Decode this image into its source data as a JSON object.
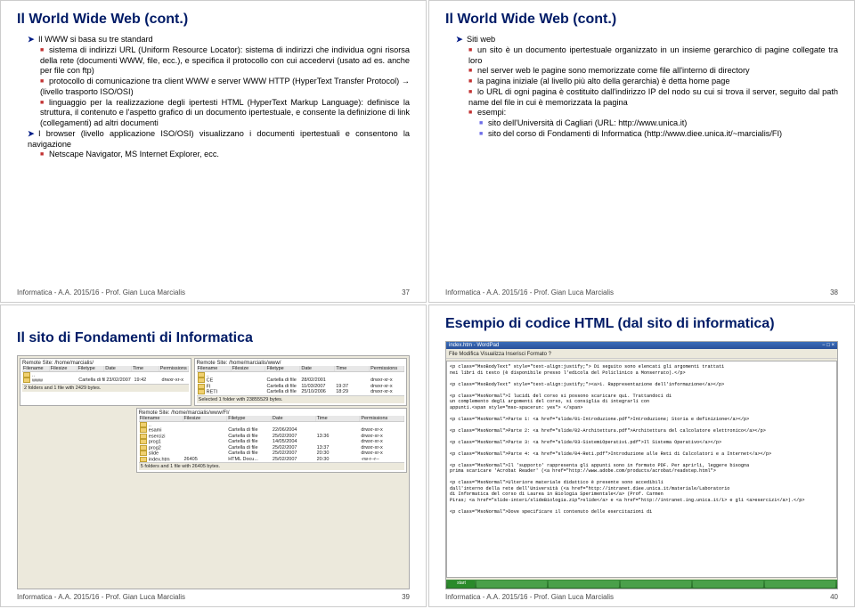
{
  "footer": "Informatica - A.A. 2015/16 - Prof. Gian Luca Marcialis",
  "slides": {
    "s37": {
      "title": "Il World Wide Web (cont.)",
      "num": "37",
      "b1": "Il WWW si basa su tre standard",
      "b1a": "sistema di indirizzi URL (Uniform Resource Locator): sistema di indirizzi che individua ogni risorsa della rete (documenti WWW, file, ecc.), e specifica il protocollo con cui accedervi (usato ad es. anche per file con ftp)",
      "b1b": "protocollo di comunicazione tra client WWW e server WWW HTTP (HyperText Transfer Protocol) → (livello trasporto ISO/OSI)",
      "b1c": "linguaggio per la realizzazione degli ipertesti HTML (HyperText Markup Language): definisce la struttura, il contenuto e l'aspetto grafico di un documento ipertestuale, e consente la definizione di link (collegamenti) ad altri documenti",
      "b2": "I browser (livello applicazione ISO/OSI) visualizzano i documenti ipertestuali e consentono la navigazione",
      "b2a": "Netscape Navigator, MS Internet Explorer, ecc."
    },
    "s38": {
      "title": "Il World Wide Web (cont.)",
      "num": "38",
      "b1": "Siti web",
      "b1a": "un sito è un documento ipertestuale organizzato in un insieme gerarchico di pagine collegate tra loro",
      "b1b": "nel server web le pagine sono memorizzate come file all'interno di directory",
      "b1c": "la pagina iniziale (al livello più alto della gerarchia) è detta home page",
      "b1d": "lo URL di ogni pagina è costituito dall'indirizzo IP del nodo su cui si trova il server, seguito dal path name del file in cui è memorizzata la pagina",
      "b1e": "esempi:",
      "b1e1": "sito dell'Università di Cagliari (URL: http://www.unica.it)",
      "b1e2": "sito del corso di Fondamenti di Informatica (http://www.diee.unica.it/~marcialis/FI)"
    },
    "s39": {
      "title": "Il sito di Fondamenti di Informatica",
      "num": "39",
      "ftp": {
        "remote_label": "Remote Site:",
        "remote_path": "/home/marcialis/",
        "cols": [
          "Filename",
          "Filesize",
          "Filetype",
          "Date",
          "Time",
          "Permissions"
        ],
        "left_rows": [
          [
            "..",
            "",
            "",
            "",
            "",
            ""
          ],
          [
            "www",
            "",
            "Cartella di file",
            "23/02/2007",
            "19:42",
            "drwxr-xr-x"
          ]
        ],
        "left_status": "2 folders and 1 file with 2429 bytes.",
        "sub_remote": "Remote Site: /home/marcialis/www/",
        "mid_rows": [
          [
            "..",
            "",
            "",
            "",
            "",
            ""
          ],
          [
            "CE",
            "",
            "Cartella di file",
            "28/02/2001",
            "",
            "drwxr-xr-x"
          ],
          [
            "FI",
            "",
            "Cartella di file",
            "11/03/2007",
            "19:37",
            "drwxr-xr-x"
          ],
          [
            "RETI",
            "",
            "Cartella di file",
            "25/10/2006",
            "18:29",
            "drwxr-xr-x"
          ]
        ],
        "mid_status": "Selected 1 folder with 23855529 bytes.",
        "right_label": "Remote Site: /home/marcialis/www/FI/",
        "right_rows": [
          [
            "..",
            "",
            "",
            "",
            "",
            ""
          ],
          [
            "esami",
            "",
            "Cartella di file",
            "22/06/2004",
            "",
            "drwxr-xr-x"
          ],
          [
            "esercizi",
            "",
            "Cartella di file",
            "25/02/2007",
            "13:36",
            "drwxr-xr-x"
          ],
          [
            "prog1",
            "",
            "Cartella di file",
            "14/05/2004",
            "",
            "drwxr-xr-x"
          ],
          [
            "prog2",
            "",
            "Cartella di file",
            "25/02/2007",
            "13:37",
            "drwxr-xr-x"
          ],
          [
            "slide",
            "",
            "Cartella di file",
            "25/02/2007",
            "20:30",
            "drwxr-xr-x"
          ],
          [
            "index.htm",
            "26405",
            "HTML Docu...",
            "25/02/2007",
            "20:30",
            "-rw-r--r--"
          ]
        ],
        "right_status": "5 folders and 1 file with 26405 bytes."
      }
    },
    "s40": {
      "title": "Esempio di codice HTML (dal sito di informatica)",
      "num": "40",
      "wp": {
        "win": "index.htm - WordPad",
        "menu": "File  Modifica  Visualizza  Inserisci  Formato  ?",
        "code": [
          "<p class=\"MsoBodyText\" style=\"text-align:justify;\"> Di seguito sono elencati gli argomenti trattati",
          "  nei libri di testo (è disponibile presso l'edicola del Policlinico a Monserrato).</p>",
          "",
          "<p class=\"MsoBodyText\" style=\"text-align:justify;\"><a>1. Rappresentazione dell'informazione</a></p>",
          "",
          "<p class=\"MsoNormal\">I lucidi del corso si possono scaricare qui. Trattandoci di",
          "  un complemento degli argomenti del corso, si consiglia di integrarli con",
          "  appunti.<span style=\"mso-spacerun: yes\"> </span>",
          "",
          "<p class=\"MsoNormal\">Parte 1: <a href=\"slide/01-Introduzione.pdf\">Introduzione; Storia e definizione</a></p>",
          "",
          "<p class=\"MsoNormal\">Parte 2: <a href=\"slide/02-Architettura.pdf\">Architettura del calcolatore elettronico</a></p>",
          "",
          "<p class=\"MsoNormal\">Parte 3: <a href=\"slide/03-SistemiOperativi.pdf\">Il Sistema Operativo</a></p>",
          "",
          "<p class=\"MsoNormal\">Parte 4: <a href=\"slide/04-Reti.pdf\">Introduzione alle Reti di Calcolatori e a Internet</a></p>",
          "",
          "<p class=\"MsoNormal\">Il 'supporto' rappresenta gli appunti sono in formato PDF. Per aprirli, leggere bisogna",
          "  prima scaricare 'Acrobat Reader' (<a href=\"http://www.adobe.com/products/acrobat/readstep.html\">",
          "",
          "<p class=\"MsoNormal\">Ulteriore materiale didattico è presente sono accedibili",
          "  dall'interno della rete dell'Università (<a href=\"http://intranet.diee.unica.it/materiale/Laboratorio",
          "  di Informatica del corso di Laurea in Biologia Sperimentale</a> (Prof. Carmen",
          "  Piras; <a href=\"slide-interi/slideBiologia.zip\">slide</a> e <a href=\"http://intranet.ing.unica.it/i> e gli <a>esercizi</a>).</p>",
          "",
          "<p class=\"MsoNormal\">Dove specificare il contenuto delle esercitazioni di"
        ]
      }
    }
  }
}
